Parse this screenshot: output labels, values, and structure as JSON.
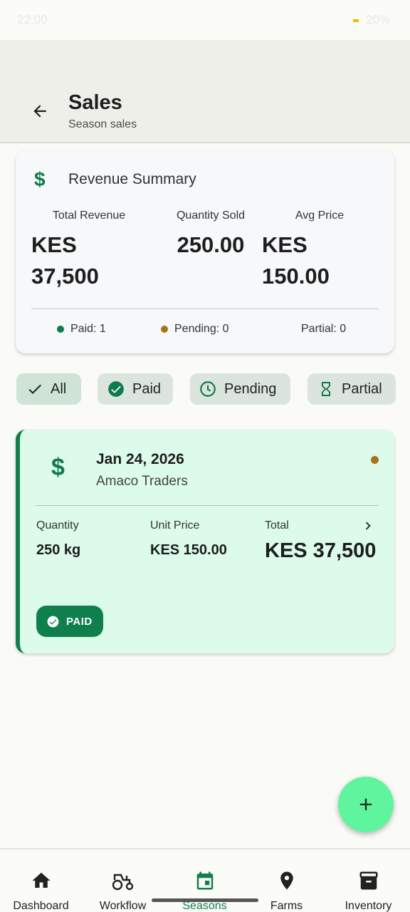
{
  "status_bar": {
    "time": "22:00",
    "battery": "20%"
  },
  "header": {
    "title": "Sales",
    "subtitle": "Season sales"
  },
  "revenue_summary": {
    "title": "Revenue Summary",
    "total_revenue_label": "Total Revenue",
    "total_revenue_currency": "KES",
    "total_revenue_value": "37,500",
    "quantity_sold_label": "Quantity Sold",
    "quantity_sold_value": "250.00",
    "avg_price_label": "Avg Price",
    "avg_price_currency": "KES",
    "avg_price_value": "150.00",
    "paid_count": "Paid: 1",
    "pending_count": "Pending: 0",
    "partial_count": "Partial: 0"
  },
  "filters": {
    "all": "All",
    "paid": "Paid",
    "pending": "Pending",
    "partial": "Partial",
    "selected": "All"
  },
  "sales": [
    {
      "date": "Jan 24, 2026",
      "buyer": "Amaco Traders",
      "quantity_label": "Quantity",
      "quantity": "250 kg",
      "unit_price_label": "Unit Price",
      "unit_price": "KES 150.00",
      "total_label": "Total",
      "total": "KES 37,500",
      "status": "PAID"
    }
  ],
  "bottom_nav": {
    "dashboard": "Dashboard",
    "workflow": "Workflow",
    "seasons": "Seasons",
    "farms": "Farms",
    "inventory": "Inventory",
    "active": "Seasons"
  },
  "colors": {
    "accent": "#10804d",
    "paid": "#0f7a4a",
    "pending": "#a6731a",
    "fab": "#5ef59e"
  },
  "icons": [
    "back-arrow-icon",
    "dollar-icon",
    "check-icon",
    "check-circle-icon",
    "clock-icon",
    "hourglass-icon",
    "chevron-right-icon",
    "plus-icon",
    "home-icon",
    "tractor-icon",
    "calendar-icon",
    "location-pin-icon",
    "archive-icon"
  ]
}
